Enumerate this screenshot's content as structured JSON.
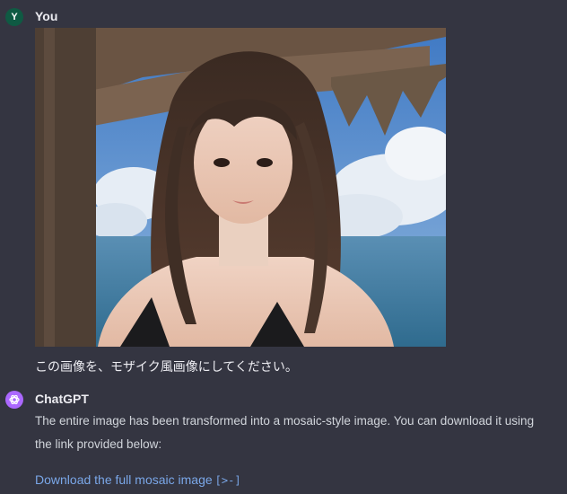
{
  "user": {
    "avatar_initial": "Y",
    "name": "You",
    "message": "この画像を、モザイク風画像にしてください。"
  },
  "assistant": {
    "name": "ChatGPT",
    "message": "The entire image has been transformed into a mosaic-style image. You can download it using the link provided below:",
    "link_label": "Download the full mosaic image",
    "link_icon": "[>-]"
  },
  "colors": {
    "background": "#343541",
    "user_avatar": "#0f5a43",
    "assistant_avatar": "#ab68ff",
    "link": "#7aa7e8"
  }
}
